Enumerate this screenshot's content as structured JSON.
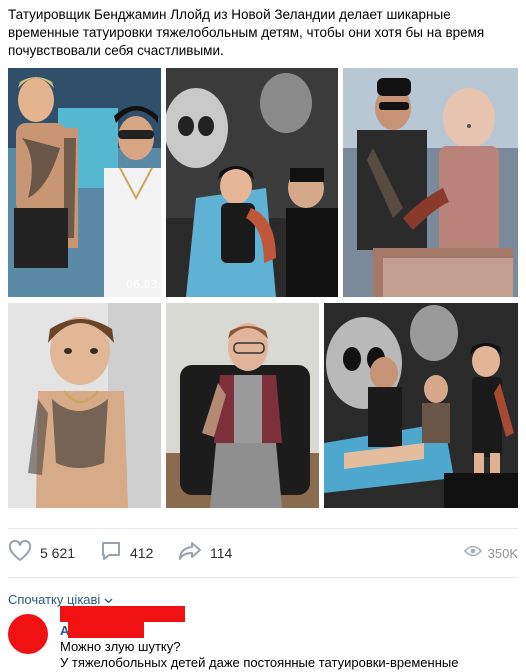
{
  "post": {
    "text": "Татуировщик Бенджамин Ллойд из Новой Зеландии делает шикарные временные татуировки тяжелобольным детям, чтобы они хотя бы на время почувствовали себя счастливыми.",
    "photo_timestamp": "06.03."
  },
  "actions": {
    "likes": "5 621",
    "comments": "412",
    "shares": "114",
    "views": "350K"
  },
  "icons": {
    "like": "heart-icon",
    "comment": "comment-bubble-icon",
    "share": "share-arrow-icon",
    "views": "eye-icon",
    "sort": "chevron-down-icon"
  },
  "comments_section": {
    "sort_label": "Спочатку цікаві"
  },
  "comment": {
    "author_initial": "А",
    "line1": "Можно злую шутку?",
    "line2": "У тяжелобольных детей даже постоянные татуировки-временные"
  },
  "colors": {
    "link": "#2a5885",
    "redaction": "#f01212",
    "icon": "#99a2ad"
  }
}
